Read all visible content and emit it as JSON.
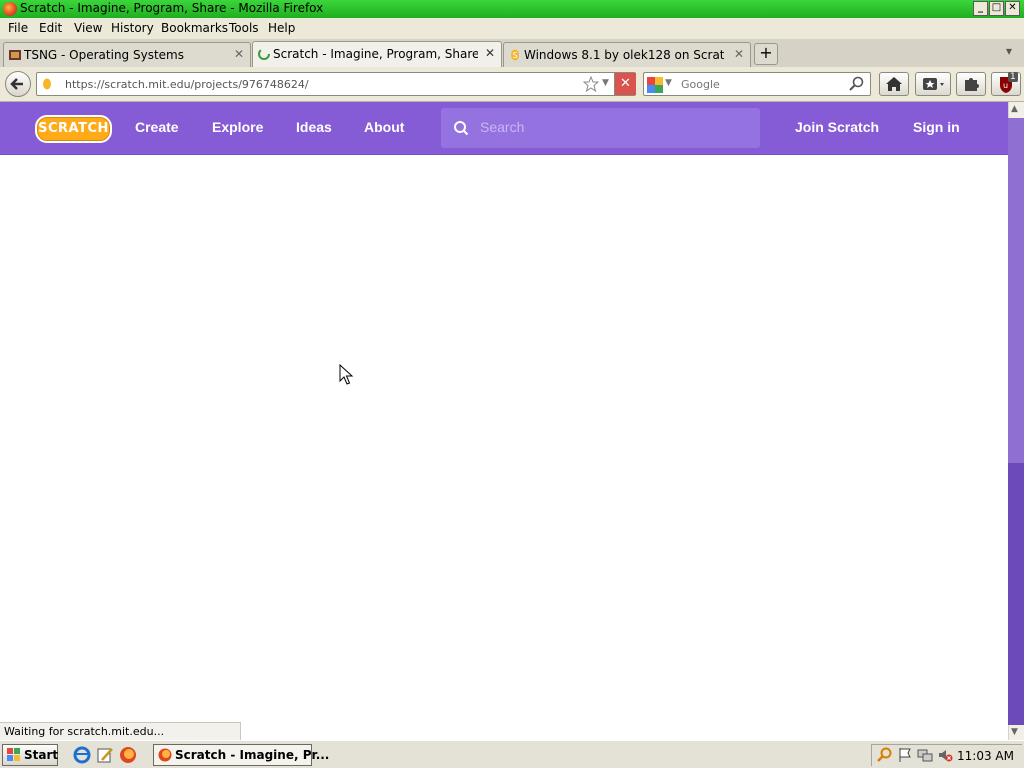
{
  "window": {
    "title": "Scratch - Imagine, Program, Share - Mozilla Firefox",
    "controls": {
      "minimize": "_",
      "maximize": "□",
      "close": "✕"
    }
  },
  "menu": [
    "File",
    "Edit",
    "View",
    "History",
    "Bookmarks",
    "Tools",
    "Help"
  ],
  "tabs": [
    {
      "label": "TSNG - Operating Systems",
      "close": "✕"
    },
    {
      "label": "Scratch - Imagine, Program, Share",
      "close": "✕"
    },
    {
      "label": "Windows 8.1 by olek128 on Scratch",
      "close": "✕"
    }
  ],
  "new_tab": "+",
  "tab_list": "▾",
  "address": {
    "url": "https://scratch.mit.edu/projects/976748624/"
  },
  "search_engine": {
    "placeholder": "Google"
  },
  "addon_badge": "1",
  "scratch": {
    "logo": "SCRATCH",
    "nav": [
      "Create",
      "Explore",
      "Ideas",
      "About"
    ],
    "search_placeholder": "Search",
    "join": "Join Scratch",
    "signin": "Sign in"
  },
  "status_text": "Waiting for scratch.mit.edu...",
  "taskbar": {
    "start": "Start",
    "task": "Scratch - Imagine, Pr...",
    "clock": "11:03 AM"
  },
  "colors": {
    "scratch_purple": "#855cd6",
    "scratch_orange": "#ffab19",
    "titlebar_green": "#2cc12c"
  }
}
